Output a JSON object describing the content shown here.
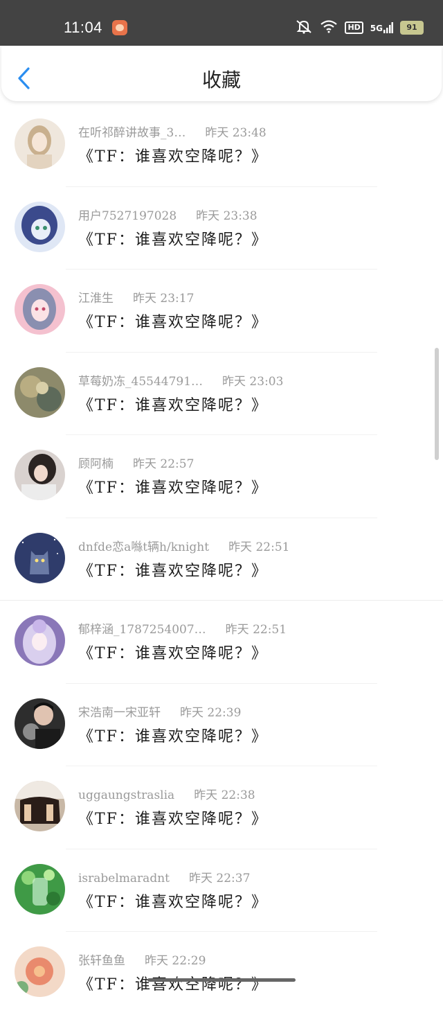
{
  "status_bar": {
    "time": "11:04",
    "icons": [
      "app-notification-icon",
      "bell-muted-icon",
      "wifi-icon",
      "hd-icon",
      "5g-signal-icon",
      "battery-icon"
    ],
    "hd_label": "HD",
    "network_label": "5G",
    "battery_level": "91"
  },
  "header": {
    "title": "收藏",
    "back_icon": "chevron-left-icon",
    "accent_color": "#2b8ef0"
  },
  "favorites": [
    {
      "user": "在听祁醉讲故事_3…",
      "time": "昨天 23:48",
      "content": "《TF：谁喜欢空降呢？》",
      "avatar_color": "#e9dccd"
    },
    {
      "user": "用户7527197028",
      "time": "昨天 23:38",
      "content": "《TF：谁喜欢空降呢？》",
      "avatar_color": "#3b4a8c"
    },
    {
      "user": "江淮生",
      "time": "昨天 23:17",
      "content": "《TF：谁喜欢空降呢？》",
      "avatar_color": "#f2b3c4"
    },
    {
      "user": "草莓奶冻_45544791…",
      "time": "昨天 23:03",
      "content": "《TF：谁喜欢空降呢？》",
      "avatar_color": "#8d8a6b"
    },
    {
      "user": "顾阿楠",
      "time": "昨天 22:57",
      "content": "《TF：谁喜欢空降呢？》",
      "avatar_color": "#4a3f3c"
    },
    {
      "user": "dnfde恋a噝t辆h/knight",
      "time": "昨天 22:51",
      "content": "《TF：谁喜欢空降呢？》",
      "avatar_color": "#3e4d7c"
    },
    {
      "user": "郁梓涵_1787254007…",
      "time": "昨天 22:51",
      "content": "《TF：谁喜欢空降呢？》",
      "avatar_color": "#b6a3d9"
    },
    {
      "user": "宋浩南一宋亚轩",
      "time": "昨天 22:39",
      "content": "《TF：谁喜欢空降呢？》",
      "avatar_color": "#2d2d2d"
    },
    {
      "user": "uggaungstraslia",
      "time": "昨天 22:38",
      "content": "《TF：谁喜欢空降呢？》",
      "avatar_color": "#6b4b35"
    },
    {
      "user": "israbelmaradnt",
      "time": "昨天 22:37",
      "content": "《TF：谁喜欢空降呢？》",
      "avatar_color": "#4caf50"
    },
    {
      "user": "张轩鱼鱼",
      "time": "昨天 22:29",
      "content": "《TF：谁喜欢空降呢？》",
      "avatar_color": "#e98a6d"
    }
  ]
}
